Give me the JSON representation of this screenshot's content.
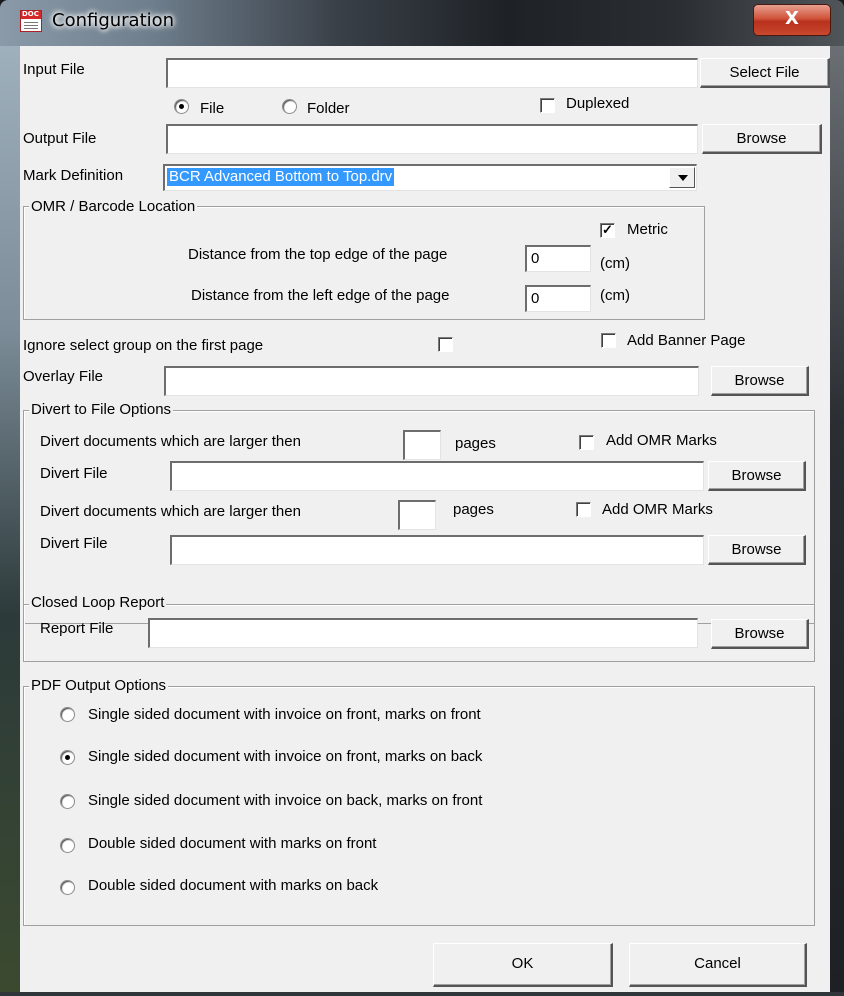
{
  "window": {
    "title": "Configuration",
    "close_glyph": "X",
    "icon_text": "DOC"
  },
  "input": {
    "label": "Input File",
    "value": "",
    "button": "Select File",
    "radio_file": "File",
    "radio_folder": "Folder",
    "selected": "File",
    "duplexed_label": "Duplexed",
    "duplexed_checked": false
  },
  "output": {
    "label": "Output File",
    "value": "",
    "button": "Browse"
  },
  "mark_definition": {
    "label": "Mark Definition",
    "value": "BCR Advanced Bottom to Top.drv"
  },
  "omr": {
    "legend": "OMR / Barcode Location",
    "metric_label": "Metric",
    "metric_checked": true,
    "top_label": "Distance from the top edge of the page",
    "top_value": "0",
    "left_label": "Distance from the left edge of the page",
    "left_value": "0",
    "unit": "(cm)"
  },
  "ignore_select": {
    "label": "Ignore select group on the first page",
    "checked": false
  },
  "banner": {
    "label": "Add Banner Page",
    "checked": false
  },
  "overlay": {
    "label": "Overlay File",
    "value": "",
    "button": "Browse"
  },
  "divert": {
    "legend": "Divert to File Options",
    "rows": [
      {
        "label": "Divert documents which are larger then",
        "pages_value": "",
        "pages_label": "pages",
        "omr_label": "Add OMR Marks",
        "omr_checked": false,
        "file_label": "Divert File",
        "file_value": "",
        "button": "Browse"
      },
      {
        "label": "Divert documents which are larger then",
        "pages_value": "",
        "pages_label": "pages",
        "omr_label": "Add OMR Marks",
        "omr_checked": false,
        "file_label": "Divert File",
        "file_value": "",
        "button": "Browse"
      }
    ]
  },
  "closed_loop": {
    "legend": "Closed Loop Report",
    "label": "Report File",
    "value": "",
    "button": "Browse"
  },
  "pdf": {
    "legend": "PDF Output Options",
    "selected_index": 1,
    "options": [
      "Single sided document with invoice on front, marks on front",
      "Single sided document with invoice on front, marks on back",
      "Single sided document with invoice on back, marks on front",
      "Double sided document with marks on front",
      "Double sided document with marks on back"
    ]
  },
  "footer": {
    "ok": "OK",
    "cancel": "Cancel"
  }
}
